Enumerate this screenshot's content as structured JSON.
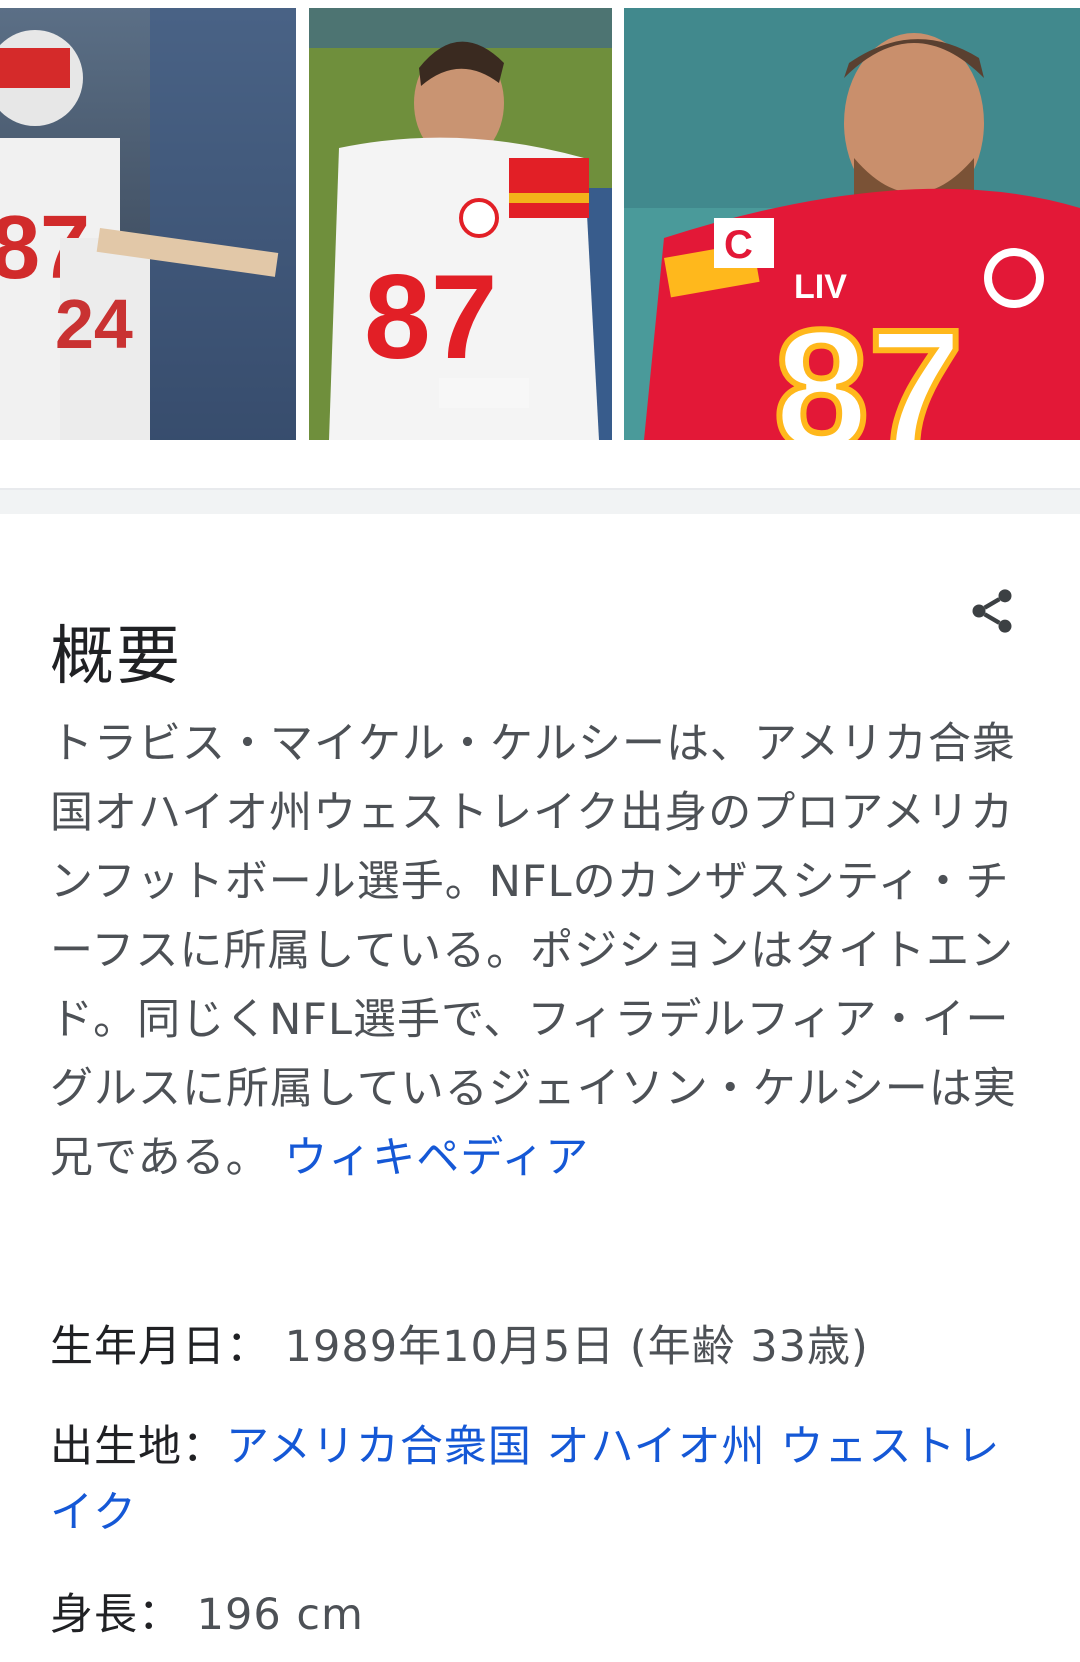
{
  "images": [
    {
      "alt_icon": "player-photo-1"
    },
    {
      "alt_icon": "player-photo-2"
    },
    {
      "alt_icon": "player-photo-3"
    }
  ],
  "overview": {
    "title": "概要",
    "summary": "トラビス・マイケル・ケルシーは、アメリカ合衆国オハイオ州ウェストレイク出身のプロアメリカンフットボール選手。NFLのカンザスシティ・チーフスに所属している。ポジションはタイトエンド。同じくNFL選手で、フィラデルフィア・イーグルスに所属しているジェイソン・ケルシーは実兄である。",
    "source_link": "ウィキペディア"
  },
  "facts": {
    "birth_label": "生年月日：",
    "birth_value": "1989年10月5日 (年齢 33歳)",
    "place_label": "出生地：",
    "place_country": "アメリカ合衆国",
    "place_state": "オハイオ州",
    "place_city": "ウェストレイク",
    "height_label": "身長：",
    "height_value": "196 cm"
  },
  "colors": {
    "link": "#1558d6",
    "text": "#4d5156",
    "heading": "#202124",
    "chiefs_red": "#e31837",
    "chiefs_gold": "#ffb81c"
  }
}
